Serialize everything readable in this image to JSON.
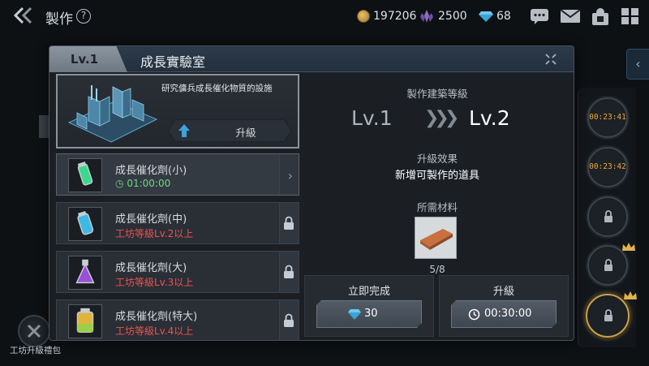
{
  "topbar": {
    "title": "製作",
    "help": "?",
    "resources": [
      {
        "icon": "coin-icon",
        "value": "197206"
      },
      {
        "icon": "crystal-icon",
        "value": "2500"
      },
      {
        "icon": "diamond-icon",
        "value": "68"
      }
    ]
  },
  "panel": {
    "level_tab": "Lv.1",
    "title": "成長實驗室",
    "building": {
      "description": "研究傭兵成長催化物質的設施",
      "upgrade_label": "升級"
    },
    "items": [
      {
        "name": "成長催化劑(小)",
        "sub": "01:00:00",
        "state": "available"
      },
      {
        "name": "成長催化劑(中)",
        "sub": "工坊等級Lv.2以上",
        "state": "locked"
      },
      {
        "name": "成長催化劑(大)",
        "sub": "工坊等級Lv.3以上",
        "state": "locked"
      },
      {
        "name": "成長催化劑(特大)",
        "sub": "工坊等級Lv.4以上",
        "state": "locked"
      }
    ],
    "upgrade_info": {
      "heading": "製作建築等級",
      "from": "Lv.1",
      "to": "Lv.2",
      "effect_heading": "升級效果",
      "effect_text": "新增可製作的道具",
      "materials_heading": "所需材料",
      "material_count": "5/8"
    },
    "actions": {
      "instant": {
        "title": "立即完成",
        "cost": "30"
      },
      "upgrade": {
        "title": "升級",
        "time": "00:30:00"
      }
    }
  },
  "queue": {
    "timers": [
      "00:23:41",
      "00:23:42"
    ]
  },
  "bottom_left": {
    "label": "工坊升級禮包"
  },
  "colors": {
    "timer": "#f1a63a",
    "available_time": "#6cd884",
    "requirement": "#f0514f",
    "gold_ring": "#c9a24a"
  }
}
